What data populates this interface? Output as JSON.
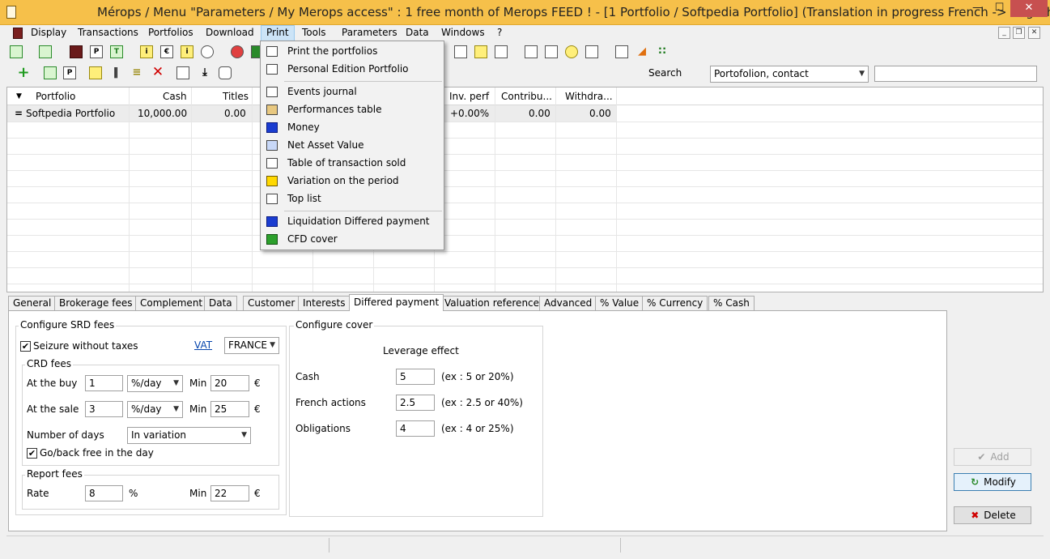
{
  "window": {
    "title": "Mérops / Menu \"Parameters / My Merops access\" : 1 free month of Merops FEED ! - [1 Portfolio / Softpedia Portfolio] (Translation in progress French -> English)",
    "minimize": "—",
    "maximize": "☐",
    "close": "✕"
  },
  "menu": {
    "items": [
      "Display",
      "Transactions",
      "Portfolios",
      "Download",
      "Print",
      "Tools",
      "Parameters",
      "Data",
      "Windows",
      "?"
    ],
    "active": "Print",
    "mdi_minimize": "_",
    "mdi_restore": "❐",
    "mdi_close": "✕"
  },
  "toolbar": {
    "row1_letters": [
      "P",
      "T",
      "i",
      "€",
      "i"
    ],
    "row2_letters": [
      "+",
      "P",
      "✕"
    ]
  },
  "search": {
    "label": "Search",
    "scope_value": "Portofolion, contact",
    "query_value": ""
  },
  "grid": {
    "columns": [
      "Portfolio",
      "Cash",
      "Titles",
      "Inv. perf",
      "Contribu...",
      "Withdra..."
    ],
    "rows": [
      {
        "marker": "=",
        "portfolio": "Softpedia Portfolio",
        "cash": "10,000.00",
        "titles": "0.00",
        "inv_perf": "+0.00%",
        "contrib": "0.00",
        "withdraw": "0.00"
      }
    ]
  },
  "print_menu": {
    "items": [
      {
        "label": "Print the portfolios",
        "icon": "printer-icon"
      },
      {
        "label": "Personal Edition Portfolio",
        "icon": "printer-icon"
      },
      {
        "label": "Events journal",
        "icon": "journal-icon"
      },
      {
        "label": "Performances table",
        "icon": "table-icon"
      },
      {
        "label": "Money",
        "icon": "money-icon"
      },
      {
        "label": "Net Asset Value",
        "icon": "nav-icon"
      },
      {
        "label": "Table of transaction sold",
        "icon": "transactions-icon"
      },
      {
        "label": "Variation on the period",
        "icon": "variation-icon"
      },
      {
        "label": "Top list",
        "icon": "podium-icon"
      },
      {
        "label": "Liquidation Differed payment",
        "icon": "liquidation-icon"
      },
      {
        "label": "CFD cover",
        "icon": "cfd-icon"
      }
    ]
  },
  "tabs": [
    "General",
    "Brokerage fees",
    "Complement",
    "Data",
    "Customer",
    "Interests",
    "Differed payment",
    "Valuation reference",
    "Advanced",
    "% Value",
    "% Currency",
    "% Cash"
  ],
  "active_tab": "Differed payment",
  "srd": {
    "title": "Configure SRD fees",
    "seizure_label": "Seizure without taxes",
    "seizure_checked": "✔",
    "vat_link": "VAT",
    "country": "FRANCE",
    "crd_title": "CRD fees",
    "buy_label": "At the buy",
    "buy_value": "1",
    "buy_unit": "%/day",
    "buy_min_label": "Min",
    "buy_min": "20",
    "sale_label": "At the sale",
    "sale_value": "3",
    "sale_unit": "%/day",
    "sale_min_label": "Min",
    "sale_min": "25",
    "currency": "€",
    "days_label": "Number of days",
    "days_value": "In variation",
    "goback_label": "Go/back free in the day",
    "goback_checked": "✔",
    "report_title": "Report fees",
    "rate_label": "Rate",
    "rate_value": "8",
    "rate_unit": "%",
    "rate_min_label": "Min",
    "rate_min": "22"
  },
  "cover": {
    "title": "Configure cover",
    "leverage_heading": "Leverage effect",
    "cash_label": "Cash",
    "cash_value": "5",
    "cash_hint": "(ex : 5 or 20%)",
    "french_label": "French actions",
    "french_value": "2.5",
    "french_hint": "(ex : 2.5 or 40%)",
    "oblig_label": "Obligations",
    "oblig_value": "4",
    "oblig_hint": "(ex : 4 or 25%)"
  },
  "actions": {
    "add": "Add",
    "modify": "Modify",
    "delete": "Delete"
  }
}
